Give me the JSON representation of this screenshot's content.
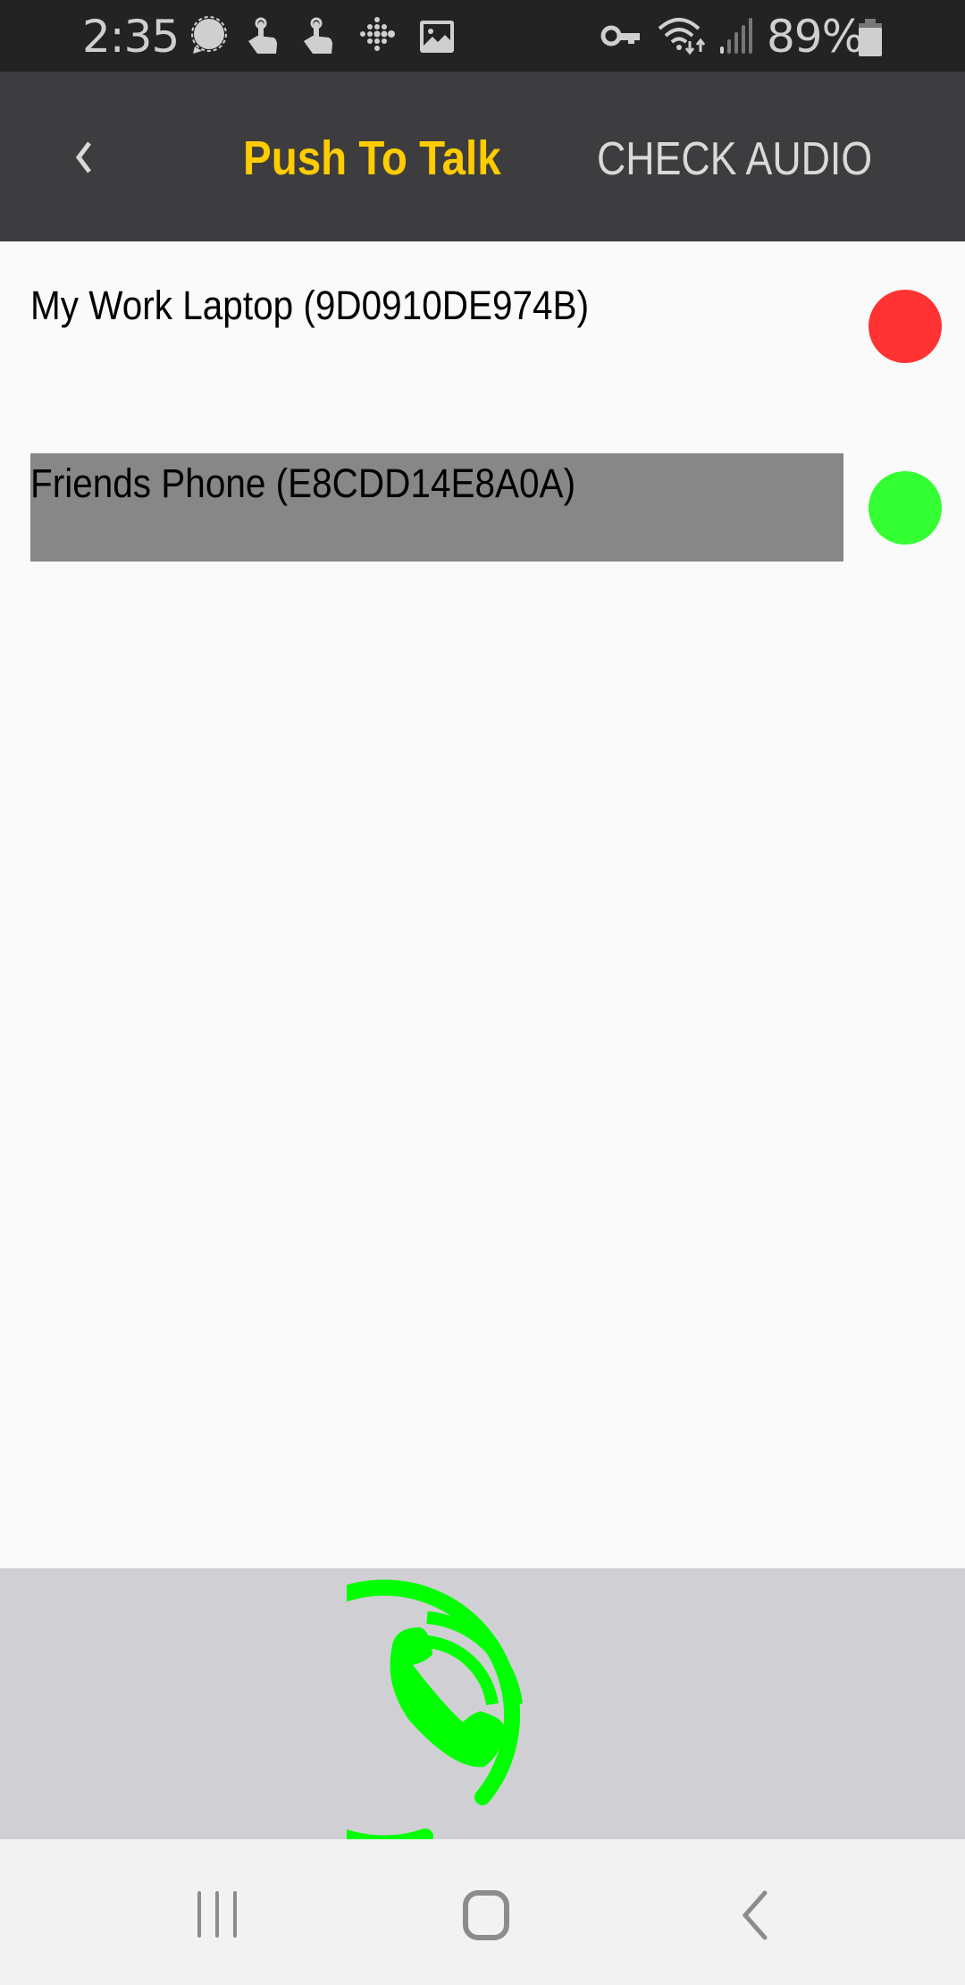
{
  "status_bar": {
    "time": "2:35",
    "battery": "89%",
    "left_icons": [
      "signal-messenger-icon",
      "touch-gesture-icon",
      "touch-gesture-icon",
      "fitbit-icon",
      "gallery-icon"
    ],
    "right_icons": [
      "vpn-key-icon",
      "wifi-icon",
      "cell-signal-icon",
      "battery-icon"
    ]
  },
  "header": {
    "back_icon": "chevron-left-icon",
    "title": "Push To Talk",
    "action": "CHECK AUDIO",
    "title_color": "#ffcc00"
  },
  "devices": [
    {
      "label": "My Work Laptop (9D0910DE974B)",
      "status": "offline",
      "status_color": "#ff3333",
      "selected": false
    },
    {
      "label": "Friends Phone (E8CDD14E8A0A)",
      "status": "online",
      "status_color": "#33ff33",
      "selected": true
    }
  ],
  "ptt": {
    "icon": "phone-call-icon",
    "color": "#00ff00"
  },
  "nav_bar": {
    "items": [
      "recent-apps-icon",
      "home-icon",
      "back-icon"
    ]
  }
}
